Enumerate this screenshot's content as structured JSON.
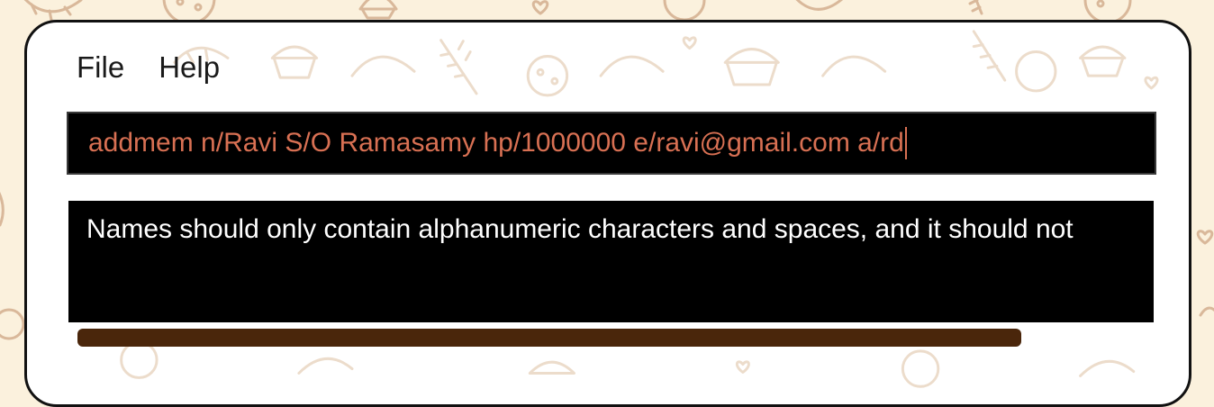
{
  "menu": {
    "items": [
      {
        "label": "File"
      },
      {
        "label": "Help"
      }
    ]
  },
  "command_box": {
    "value": "addmem n/Ravi S/O Ramasamy hp/1000000 e/ravi@gmail.com a/rd"
  },
  "result_display": {
    "text": "Names should only contain alphanumeric characters and spaces, and it should not"
  },
  "colors": {
    "page_background": "#fbf1dd",
    "doodle_stroke": "#d9b89a",
    "command_text": "#d87053",
    "scrollbar": "#4a260b"
  },
  "icons": [
    "muffin-icon",
    "croissant-icon",
    "wheat-icon",
    "heart-icon",
    "cookie-icon"
  ]
}
